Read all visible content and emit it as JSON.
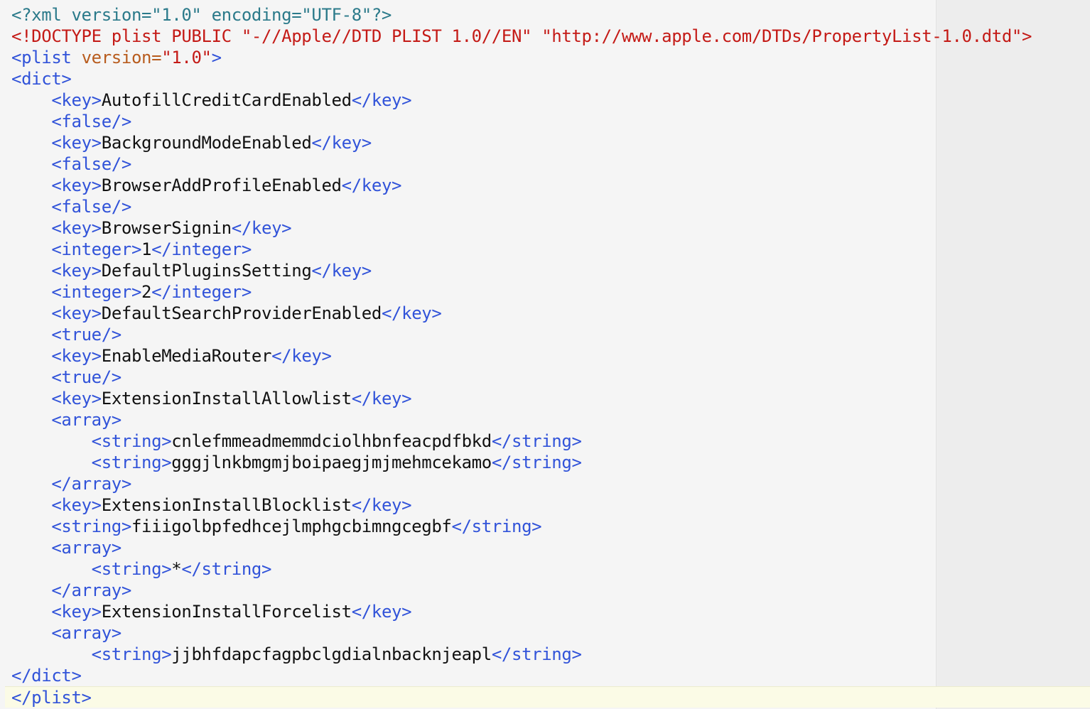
{
  "editor": {
    "lines": [
      {
        "indent": "",
        "parts": [
          {
            "t": "decl",
            "v": "<?xml version=\"1.0\" encoding=\"UTF-8\"?>"
          }
        ]
      },
      {
        "indent": "",
        "parts": [
          {
            "t": "doctype",
            "v": "<!DOCTYPE plist PUBLIC \"-//Apple//DTD PLIST 1.0//EN\" \"http://www.apple.com/DTDs/PropertyList-1.0.dtd\">"
          }
        ]
      },
      {
        "indent": "",
        "parts": [
          {
            "t": "tag",
            "v": "<plist "
          },
          {
            "t": "attr",
            "v": "version="
          },
          {
            "t": "attrval",
            "v": "\"1.0\""
          },
          {
            "t": "tag",
            "v": ">"
          }
        ]
      },
      {
        "indent": "",
        "parts": [
          {
            "t": "tag",
            "v": "<dict>"
          }
        ]
      },
      {
        "indent": "    ",
        "parts": [
          {
            "t": "tag",
            "v": "<key>"
          },
          {
            "t": "text",
            "v": "AutofillCreditCardEnabled"
          },
          {
            "t": "tag",
            "v": "</key>"
          }
        ]
      },
      {
        "indent": "    ",
        "parts": [
          {
            "t": "tag",
            "v": "<false/>"
          }
        ]
      },
      {
        "indent": "    ",
        "parts": [
          {
            "t": "tag",
            "v": "<key>"
          },
          {
            "t": "text",
            "v": "BackgroundModeEnabled"
          },
          {
            "t": "tag",
            "v": "</key>"
          }
        ]
      },
      {
        "indent": "    ",
        "parts": [
          {
            "t": "tag",
            "v": "<false/>"
          }
        ]
      },
      {
        "indent": "    ",
        "parts": [
          {
            "t": "tag",
            "v": "<key>"
          },
          {
            "t": "text",
            "v": "BrowserAddProfileEnabled"
          },
          {
            "t": "tag",
            "v": "</key>"
          }
        ]
      },
      {
        "indent": "    ",
        "parts": [
          {
            "t": "tag",
            "v": "<false/>"
          }
        ]
      },
      {
        "indent": "    ",
        "parts": [
          {
            "t": "tag",
            "v": "<key>"
          },
          {
            "t": "text",
            "v": "BrowserSignin"
          },
          {
            "t": "tag",
            "v": "</key>"
          }
        ]
      },
      {
        "indent": "    ",
        "parts": [
          {
            "t": "tag",
            "v": "<integer>"
          },
          {
            "t": "text",
            "v": "1"
          },
          {
            "t": "tag",
            "v": "</integer>"
          }
        ]
      },
      {
        "indent": "    ",
        "parts": [
          {
            "t": "tag",
            "v": "<key>"
          },
          {
            "t": "text",
            "v": "DefaultPluginsSetting"
          },
          {
            "t": "tag",
            "v": "</key>"
          }
        ]
      },
      {
        "indent": "    ",
        "parts": [
          {
            "t": "tag",
            "v": "<integer>"
          },
          {
            "t": "text",
            "v": "2"
          },
          {
            "t": "tag",
            "v": "</integer>"
          }
        ]
      },
      {
        "indent": "    ",
        "parts": [
          {
            "t": "tag",
            "v": "<key>"
          },
          {
            "t": "text",
            "v": "DefaultSearchProviderEnabled"
          },
          {
            "t": "tag",
            "v": "</key>"
          }
        ]
      },
      {
        "indent": "    ",
        "parts": [
          {
            "t": "tag",
            "v": "<true/>"
          }
        ]
      },
      {
        "indent": "    ",
        "parts": [
          {
            "t": "tag",
            "v": "<key>"
          },
          {
            "t": "text",
            "v": "EnableMediaRouter"
          },
          {
            "t": "tag",
            "v": "</key>"
          }
        ]
      },
      {
        "indent": "    ",
        "parts": [
          {
            "t": "tag",
            "v": "<true/>"
          }
        ]
      },
      {
        "indent": "    ",
        "parts": [
          {
            "t": "tag",
            "v": "<key>"
          },
          {
            "t": "text",
            "v": "ExtensionInstallAllowlist"
          },
          {
            "t": "tag",
            "v": "</key>"
          }
        ]
      },
      {
        "indent": "    ",
        "parts": [
          {
            "t": "tag",
            "v": "<array>"
          }
        ]
      },
      {
        "indent": "        ",
        "parts": [
          {
            "t": "tag",
            "v": "<string>"
          },
          {
            "t": "text",
            "v": "cnlefmmeadmemmdciolhbnfeacpdfbkd"
          },
          {
            "t": "tag",
            "v": "</string>"
          }
        ]
      },
      {
        "indent": "        ",
        "parts": [
          {
            "t": "tag",
            "v": "<string>"
          },
          {
            "t": "text",
            "v": "gggjlnkbmgmjboipaegjmjmehmcekamo"
          },
          {
            "t": "tag",
            "v": "</string>"
          }
        ]
      },
      {
        "indent": "    ",
        "parts": [
          {
            "t": "tag",
            "v": "</array>"
          }
        ]
      },
      {
        "indent": "    ",
        "parts": [
          {
            "t": "tag",
            "v": "<key>"
          },
          {
            "t": "text",
            "v": "ExtensionInstallBlocklist"
          },
          {
            "t": "tag",
            "v": "</key>"
          }
        ]
      },
      {
        "indent": "    ",
        "parts": [
          {
            "t": "tag",
            "v": "<string>"
          },
          {
            "t": "text",
            "v": "fiiigolbpfedhcejlmphgcbimngcegbf"
          },
          {
            "t": "tag",
            "v": "</string>"
          }
        ]
      },
      {
        "indent": "    ",
        "parts": [
          {
            "t": "tag",
            "v": "<array>"
          }
        ]
      },
      {
        "indent": "        ",
        "parts": [
          {
            "t": "tag",
            "v": "<string>"
          },
          {
            "t": "text",
            "v": "*"
          },
          {
            "t": "tag",
            "v": "</string>"
          }
        ]
      },
      {
        "indent": "    ",
        "parts": [
          {
            "t": "tag",
            "v": "</array>"
          }
        ]
      },
      {
        "indent": "    ",
        "parts": [
          {
            "t": "tag",
            "v": "<key>"
          },
          {
            "t": "text",
            "v": "ExtensionInstallForcelist"
          },
          {
            "t": "tag",
            "v": "</key>"
          }
        ]
      },
      {
        "indent": "    ",
        "parts": [
          {
            "t": "tag",
            "v": "<array>"
          }
        ]
      },
      {
        "indent": "        ",
        "parts": [
          {
            "t": "tag",
            "v": "<string>"
          },
          {
            "t": "text",
            "v": "jjbhfdapcfagpbclgdialnbacknjeapl"
          },
          {
            "t": "tag",
            "v": "</string>"
          }
        ]
      },
      {
        "indent": "",
        "parts": [
          {
            "t": "tag",
            "v": "</dict>"
          }
        ]
      },
      {
        "indent": "",
        "current": true,
        "parts": [
          {
            "t": "tag",
            "v": "</plist>"
          }
        ]
      }
    ]
  },
  "colors": {
    "background": "#f5f5f5",
    "declaration": "#2b7a8a",
    "doctype": "#c41a16",
    "tag": "#3153d9",
    "attribute": "#b85c1e",
    "attribute_value": "#c41a16",
    "text": "#111111",
    "current_line": "#fbfbe6"
  }
}
